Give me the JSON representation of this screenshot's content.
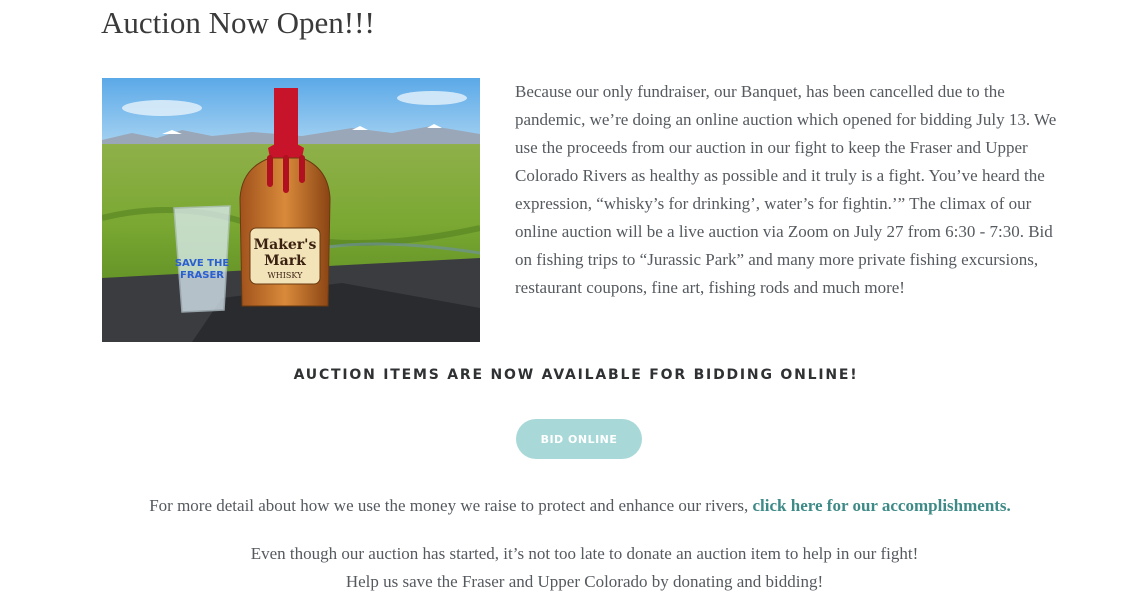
{
  "page": {
    "title": "Auction Now Open!!!"
  },
  "intro": {
    "text": "Because our only fundraiser, our Banquet, has been cancelled due to the pandemic, we’re doing an online auction which opened for bidding July 13. We use the proceeds from our auction in our fight to keep the Fraser and Upper Colorado Rivers as healthy as possible and it truly is a fight. You’ve heard the expression, “whisky’s for drinking’, water’s for fightin.’” The climax of our online auction will be a live auction via Zoom on July 27 from 6:30 - 7:30. Bid on fishing trips to “Jurassic Park” and many more private fishing excursions, restaurant coupons, fine art, fishing rods and much more!"
  },
  "hero_image": {
    "bottle_label_line1": "Maker's",
    "bottle_label_line2": "Mark",
    "bottle_label_line3": "WHISKY",
    "glass_text_line1": "SAVE THE",
    "glass_text_line2": "FRASER"
  },
  "announcement": {
    "text": "AUCTION ITEMS ARE NOW AVAILABLE FOR BIDDING ONLINE!"
  },
  "bid_button": {
    "label": "BID ONLINE"
  },
  "more_detail": {
    "text": "For more detail about how we use the money we raise to protect and enhance our rivers, ",
    "link_text": "click here for our accomplishments."
  },
  "closing": {
    "line1": "Even though our auction has started, it’s not too late to donate an auction item to help in our fight!",
    "line2": "Help us save the Fraser and Upper Colorado by donating and bidding!"
  },
  "colors": {
    "button_bg": "#a8d9d8",
    "link": "#3d8a87",
    "body_text": "#555a5f",
    "heading": "#3a3a3a"
  }
}
